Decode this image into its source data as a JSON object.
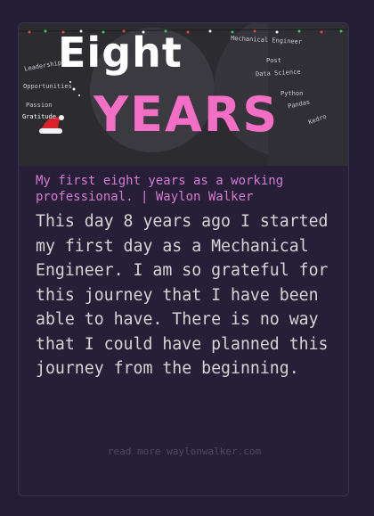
{
  "hero": {
    "eight_text": "Eight",
    "years_text": "YEARS",
    "keywords": {
      "leadership": "Leadership",
      "opportunities": "Opportunities",
      "passion": "Passion",
      "gratitude": "Gratitude",
      "mechanical_engineer": "Mechanical Engineer",
      "post": "Post",
      "data_science": "Data Science",
      "python": "Python",
      "pandas": "Pandas",
      "kedro": "Kedro"
    },
    "colors": {
      "years_pink": "#f36fc6",
      "eight_white": "#ffffff",
      "hat_red": "#d8232a"
    }
  },
  "card": {
    "title": "My first eight years as a working professional. | Waylon Walker",
    "description": "This day 8 years ago I started my first day as a Mechanical Engineer. I am so grateful for this journey that I have been able to have. There is no way that I could have planned this journey from the beginning.",
    "read_more": "read more waylonwalker.com"
  }
}
